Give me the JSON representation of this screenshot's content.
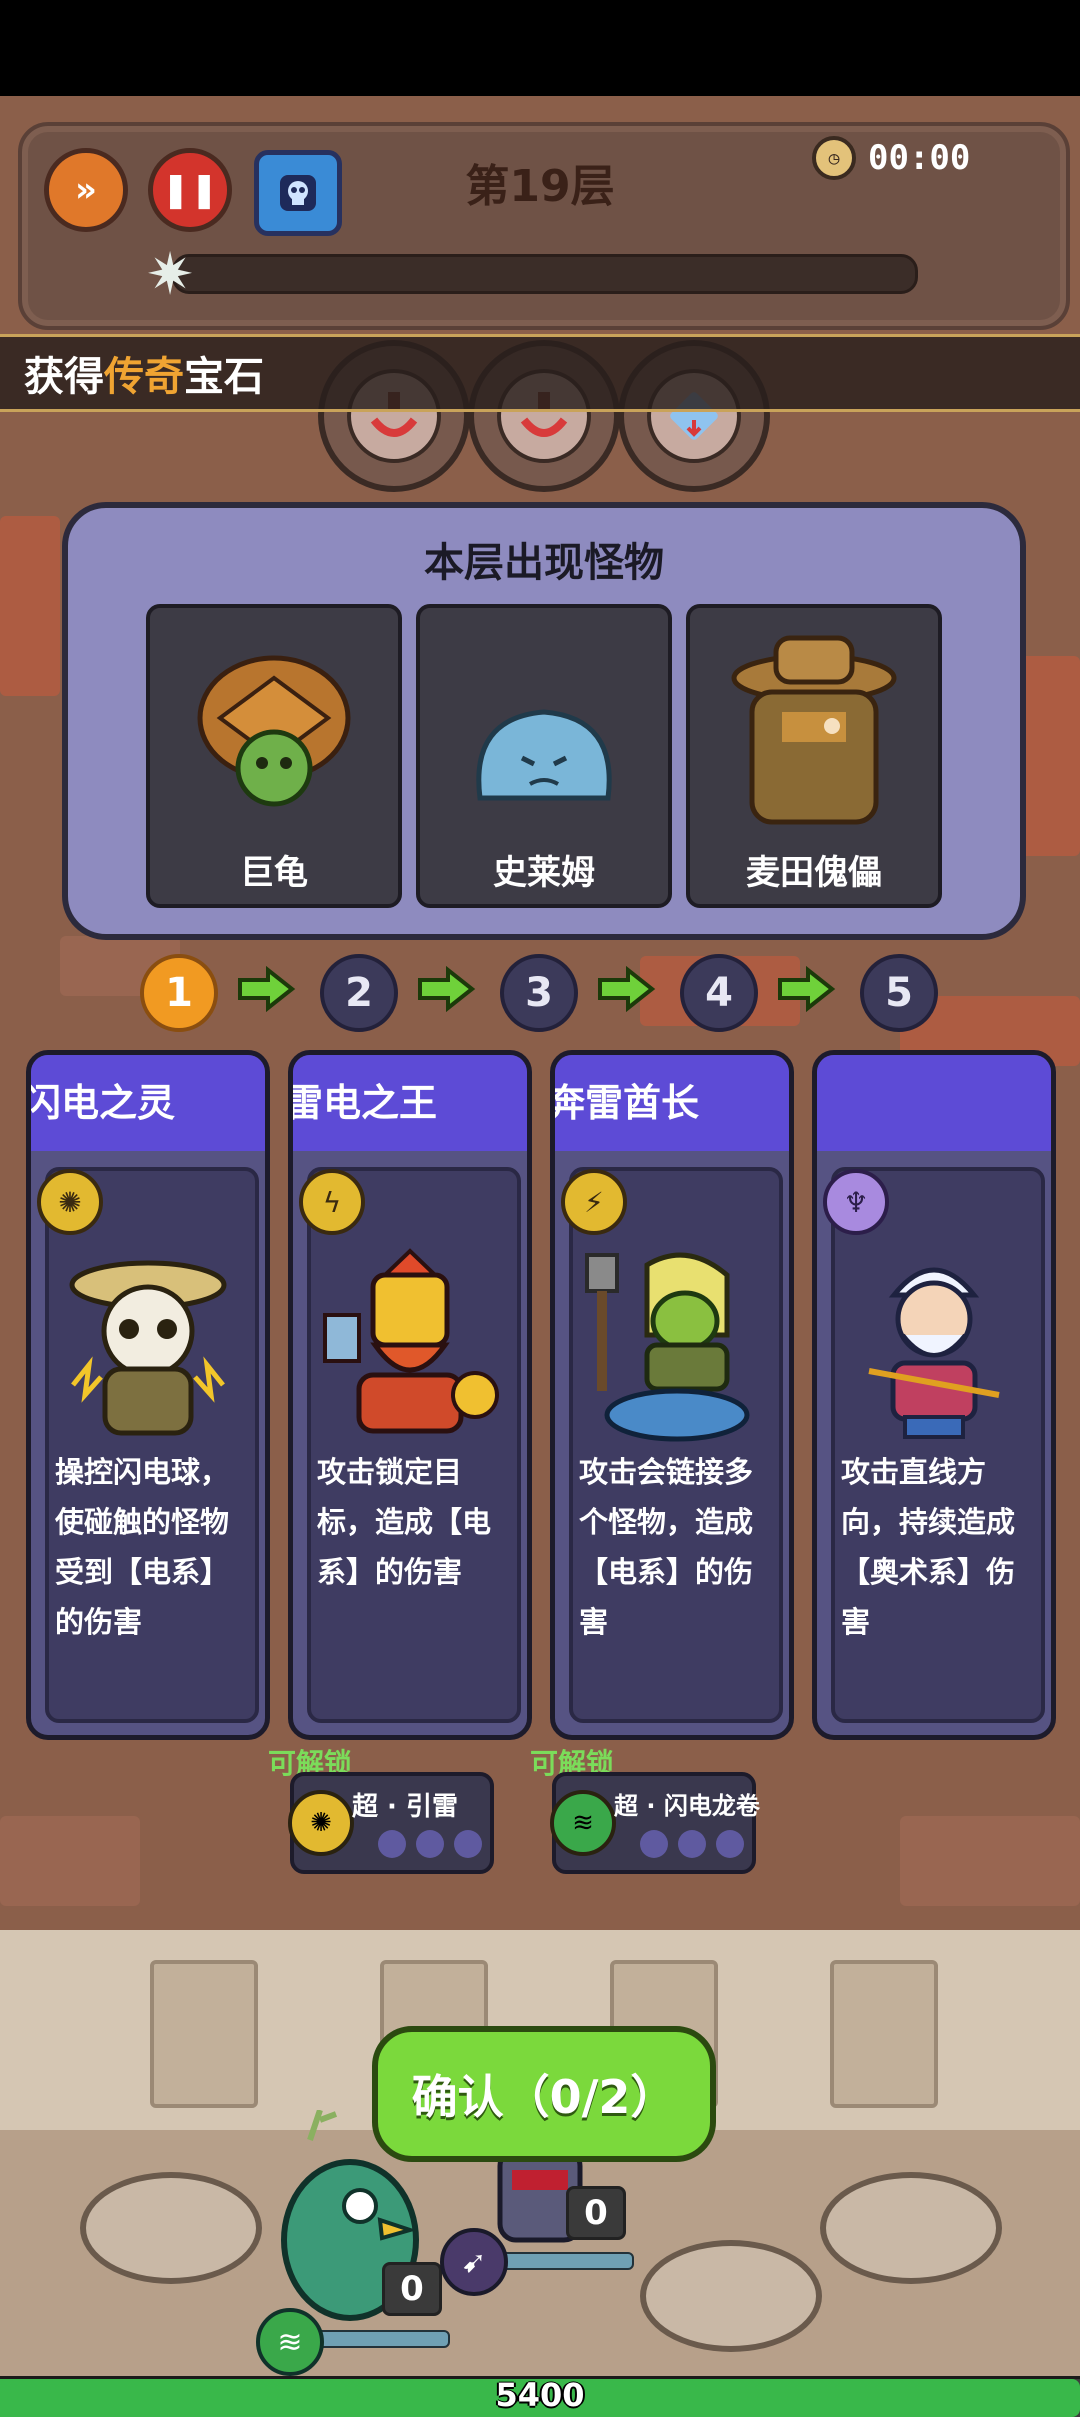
{
  "hud": {
    "floor_title": "第19层",
    "timer": "00:00",
    "wave_progress": 0
  },
  "banner": {
    "prefix": "获得",
    "highlight": "传奇",
    "suffix": "宝石"
  },
  "panel": {
    "title": "本层出现怪物",
    "monsters": [
      {
        "name": "巨龟"
      },
      {
        "name": "史莱姆"
      },
      {
        "name": "麦田傀儡"
      }
    ]
  },
  "steps": [
    "1",
    "2",
    "3",
    "4",
    "5"
  ],
  "active_step": 1,
  "cards": [
    {
      "title": "闪电之灵",
      "element": "lightning-orb",
      "desc": "操控闪电球，使碰触的怪物受到【电系】的伤害"
    },
    {
      "title": "雷电之王",
      "element": "lightning",
      "desc": "攻击锁定目标，造成【电系】的伤害"
    },
    {
      "title": "奔雷酋长",
      "element": "chain-lightning",
      "desc": "攻击会链接多个怪物，造成【电系】的伤害"
    },
    {
      "title": "",
      "element": "arcane",
      "desc": "攻击直线方向，持续造成【奥术系】伤害"
    }
  ],
  "unlocks": [
    {
      "label": "可解锁",
      "name": "超 · 引雷"
    },
    {
      "label": "可解锁",
      "name": "超 · 闪电龙卷"
    }
  ],
  "confirm": {
    "label": "确认（0/2）"
  },
  "units": [
    {
      "count": "0"
    },
    {
      "count": "0"
    }
  ],
  "base_hp": {
    "value": "5400",
    "fraction": 1.0
  },
  "colors": {
    "accent_orange": "#f19a22",
    "card_header": "#5d4bd6",
    "confirm_green": "#7bd93c",
    "hp_green": "#39b84a"
  }
}
